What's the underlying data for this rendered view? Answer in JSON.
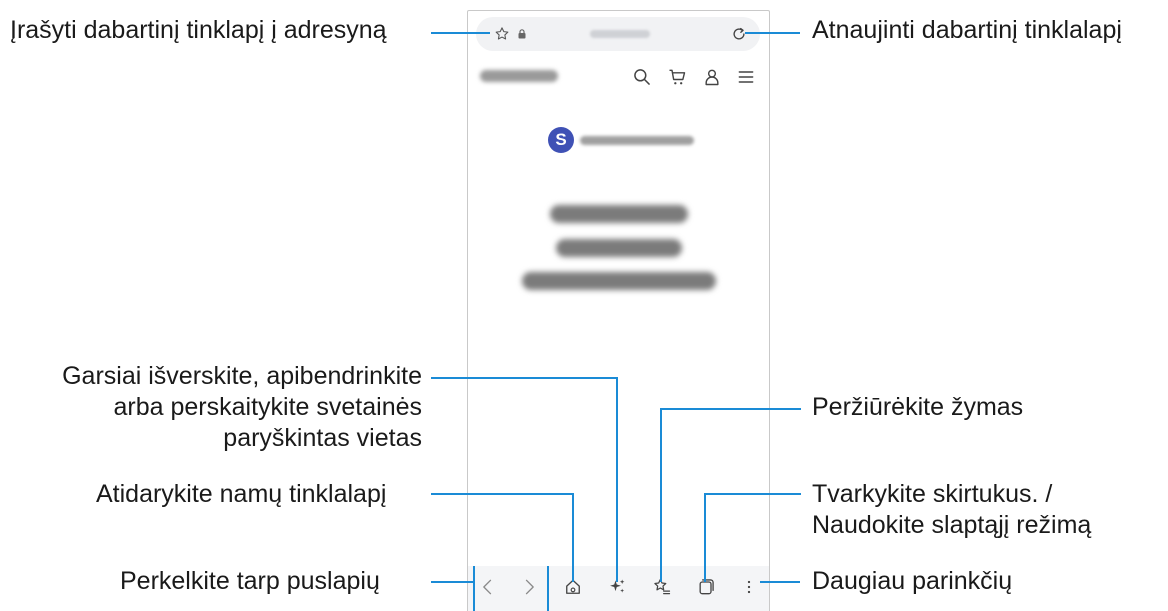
{
  "callouts": {
    "save_page": "Įrašyti dabartinį tinklapį į adresyną",
    "refresh_page": "Atnaujinti dabartinį tinklalapį",
    "translate_summarize": [
      "Garsiai išverskite, apibendrinkite",
      "arba perskaitykite svetainės",
      "paryškintas vietas"
    ],
    "view_bookmarks": "Peržiūrėkite žymas",
    "open_home": "Atidarykite namų tinklalapį",
    "manage_tabs": [
      "Tvarkykite skirtukus. /",
      "Naudokite slaptąjį režimą"
    ],
    "move_pages": "Perkelkite tarp puslapių",
    "more_options": "Daugiau parinkčių"
  },
  "phone": {
    "app_badge_letter": "S",
    "icons": {
      "bookmark_add": "star-outline-icon",
      "lock": "lock-icon",
      "refresh": "refresh-icon",
      "search": "search-icon",
      "cart": "cart-icon",
      "account": "person-icon",
      "menu": "hamburger-menu-icon",
      "back": "chevron-left-icon",
      "forward": "chevron-right-icon",
      "home": "home-icon",
      "ai_tools": "sparkle-icon",
      "bookmarks": "bookmarks-icon",
      "tabs": "tabs-icon",
      "more": "more-vertical-icon"
    }
  },
  "colors": {
    "leader_line": "#1a8bd6",
    "badge": "#3f51b5",
    "bottom_bar": "#f4f5f7",
    "url_bar": "#f1f2f4"
  }
}
